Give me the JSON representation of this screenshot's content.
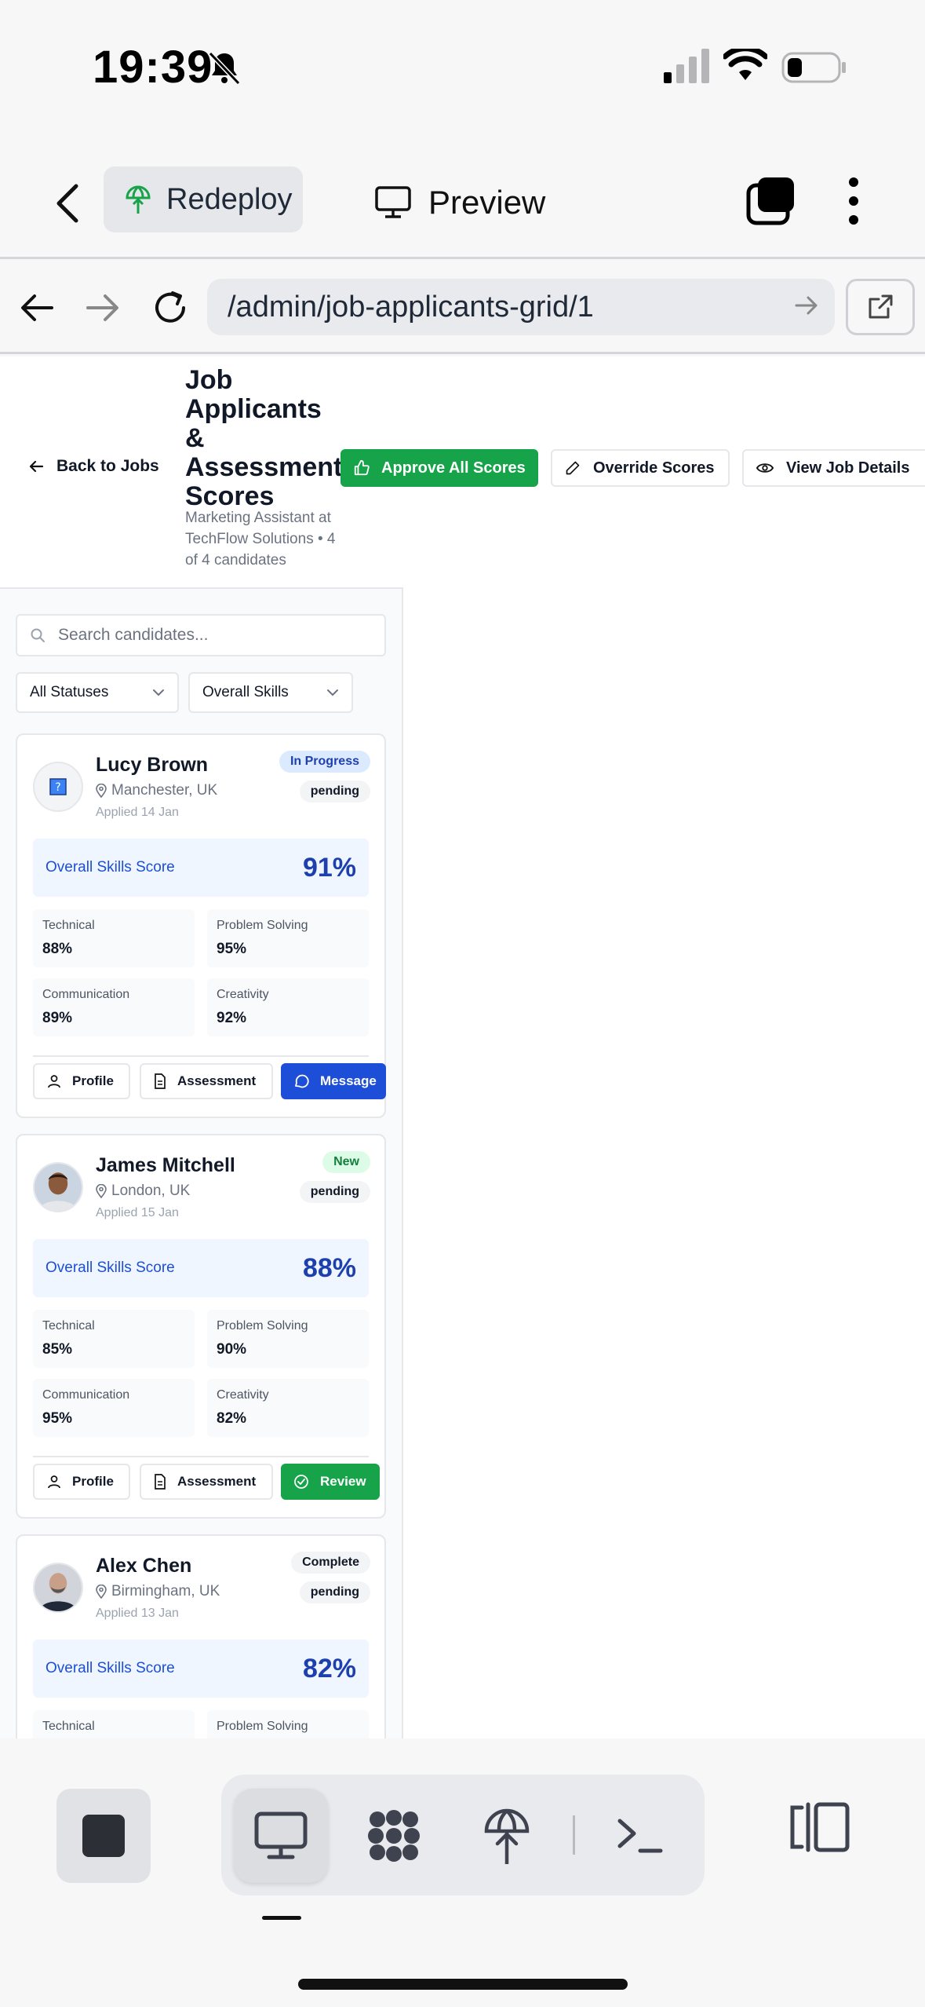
{
  "status_bar": {
    "time": "19:39"
  },
  "app_header": {
    "redeploy_label": "Redeploy",
    "preview_label": "Preview"
  },
  "browser": {
    "url": "/admin/job-applicants-grid/1"
  },
  "page": {
    "back_label": "Back to Jobs",
    "title": "Job Applicants & Assessment Scores",
    "subtitle": "Marketing Assistant at TechFlow Solutions • 4 of 4 candidates",
    "approve_label": "Approve All Scores",
    "override_label": "Override Scores",
    "view_job_label": "View Job Details"
  },
  "filters": {
    "search_placeholder": "Search candidates...",
    "status_select": "All Statuses",
    "skill_select": "Overall Skills"
  },
  "score_label": "Overall Skills Score",
  "candidates": [
    {
      "name": "Lucy Brown",
      "location": "Manchester, UK",
      "applied": "Applied 14 Jan",
      "status_badge": "In Progress",
      "review_badge": "pending",
      "overall": "91%",
      "metrics": [
        {
          "label": "Technical",
          "value": "88%"
        },
        {
          "label": "Problem Solving",
          "value": "95%"
        },
        {
          "label": "Communication",
          "value": "89%"
        },
        {
          "label": "Creativity",
          "value": "92%"
        }
      ],
      "actions": [
        "Profile",
        "Assessment",
        "Message"
      ]
    },
    {
      "name": "James Mitchell",
      "location": "London, UK",
      "applied": "Applied 15 Jan",
      "status_badge": "New",
      "review_badge": "pending",
      "overall": "88%",
      "metrics": [
        {
          "label": "Technical",
          "value": "85%"
        },
        {
          "label": "Problem Solving",
          "value": "90%"
        },
        {
          "label": "Communication",
          "value": "95%"
        },
        {
          "label": "Creativity",
          "value": "82%"
        }
      ],
      "actions": [
        "Profile",
        "Assessment",
        "Review"
      ]
    },
    {
      "name": "Alex Chen",
      "location": "Birmingham, UK",
      "applied": "Applied 13 Jan",
      "status_badge": "Complete",
      "review_badge": "pending",
      "overall": "82%",
      "metrics": [
        {
          "label": "Technical",
          "value": ""
        },
        {
          "label": "Problem Solving",
          "value": ""
        }
      ]
    }
  ],
  "colors": {
    "accent_green": "#16a34a",
    "accent_blue": "#1d4ed8",
    "score_bg": "#eff6ff"
  }
}
